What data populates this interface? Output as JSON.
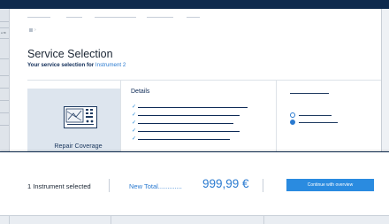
{
  "page": {
    "title": "Service Selection",
    "subtitle_prefix": "Your service selection for ",
    "subtitle_link": "Instrument 2",
    "breadcrumb_separator": "›",
    "background_mini_text": "w Bl"
  },
  "card": {
    "option_name": "Repair Coverage",
    "details_title": "Details",
    "details_items": [
      "",
      "",
      "",
      "",
      ""
    ],
    "check_icon": "✓",
    "options_selected_index": 0
  },
  "summary": {
    "selection_count": "1 Instrument selected",
    "total_label": "New Total.............",
    "total_value": "999,99 €",
    "cta_label": "Continue with overview"
  },
  "colors": {
    "navy": "#0e2a4d",
    "accent": "#2a8be0",
    "link": "#2a7ad0"
  }
}
